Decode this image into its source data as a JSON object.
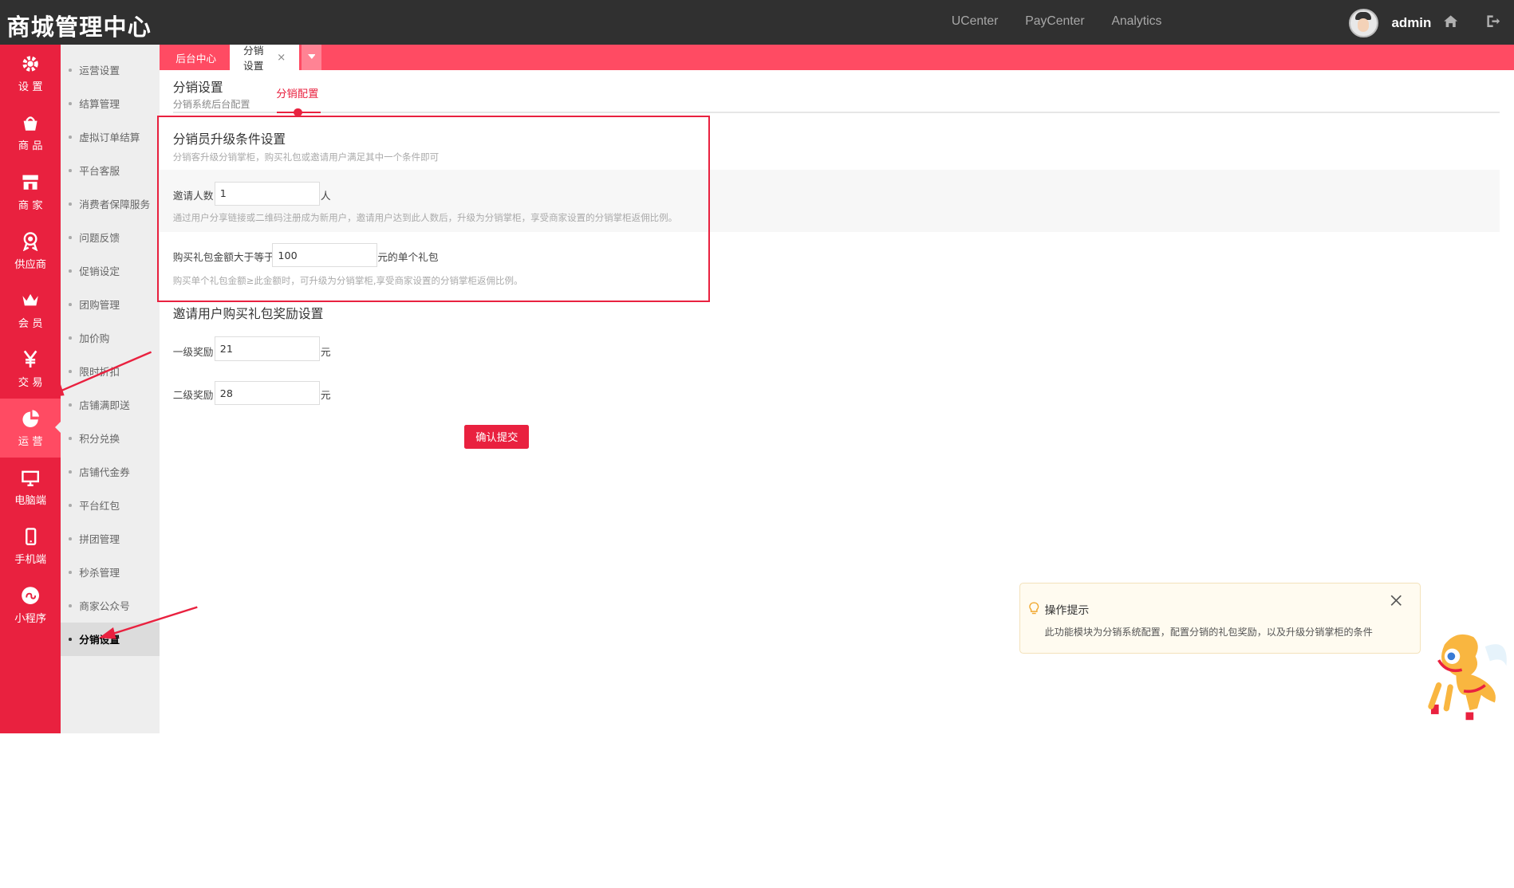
{
  "app": {
    "title": "商城管理中心"
  },
  "topnav": {
    "items": [
      "UCenter",
      "PayCenter",
      "Analytics"
    ],
    "username": "admin"
  },
  "leftnav": {
    "items": [
      {
        "label": "设 置",
        "icon": "gear-icon"
      },
      {
        "label": "商 品",
        "icon": "shopping-bag-icon"
      },
      {
        "label": "商 家",
        "icon": "store-icon"
      },
      {
        "label": "供应商",
        "icon": "medal-icon"
      },
      {
        "label": "会 员",
        "icon": "crown-icon"
      },
      {
        "label": "交 易",
        "icon": "yen-icon"
      },
      {
        "label": "运 营",
        "icon": "pie-chart-icon"
      },
      {
        "label": "电脑端",
        "icon": "monitor-icon"
      },
      {
        "label": "手机端",
        "icon": "phone-icon"
      },
      {
        "label": "小程序",
        "icon": "mini-program-icon"
      }
    ],
    "active": "运 营"
  },
  "subnav": {
    "items": [
      "运营设置",
      "结算管理",
      "虚拟订单结算",
      "平台客服",
      "消费者保障服务",
      "问题反馈",
      "促销设定",
      "团购管理",
      "加价购",
      "限时折扣",
      "店铺满即送",
      "积分兑换",
      "店铺代金券",
      "平台红包",
      "拼团管理",
      "秒杀管理",
      "商家公众号",
      "分销设置"
    ],
    "active": "分销设置"
  },
  "tabs": {
    "home": "后台中心",
    "current": "分销设置",
    "close": "×"
  },
  "page": {
    "title": "分销设置",
    "subtitle": "分销系统后台配置",
    "tab": "分销配置"
  },
  "upgrade": {
    "title": "分销员升级条件设置",
    "hint": "分销客升级分销掌柜，购买礼包或邀请用户满足其中一个条件即可",
    "invite_label": "邀请人数",
    "invite_value": "1",
    "invite_unit": "人",
    "invite_desc": "通过用户分享链接或二维码注册成为新用户，邀请用户达到此人数后，升级为分销掌柜，享受商家设置的分销掌柜返佣比例。",
    "amount_label": "购买礼包金额大于等于",
    "amount_value": "100",
    "amount_unit": "元的单个礼包",
    "amount_desc": "购买单个礼包金额≥此金额时，可升级为分销掌柜,享受商家设置的分销掌柜返佣比例。"
  },
  "reward": {
    "title": "邀请用户购买礼包奖励设置",
    "level1_label": "一级奖励",
    "level1_value": "21",
    "level2_label": "二级奖励",
    "level2_value": "28",
    "unit": "元"
  },
  "submit_label": "确认提交",
  "tip": {
    "title": "操作提示",
    "text": "此功能模块为分销系统配置，配置分销的礼包奖励，以及升级分销掌柜的条件"
  },
  "colors": {
    "topbar": "#303030",
    "brand": "#e9213f",
    "tabbar": "#ff4b63",
    "subnav": "#eeeeee"
  }
}
